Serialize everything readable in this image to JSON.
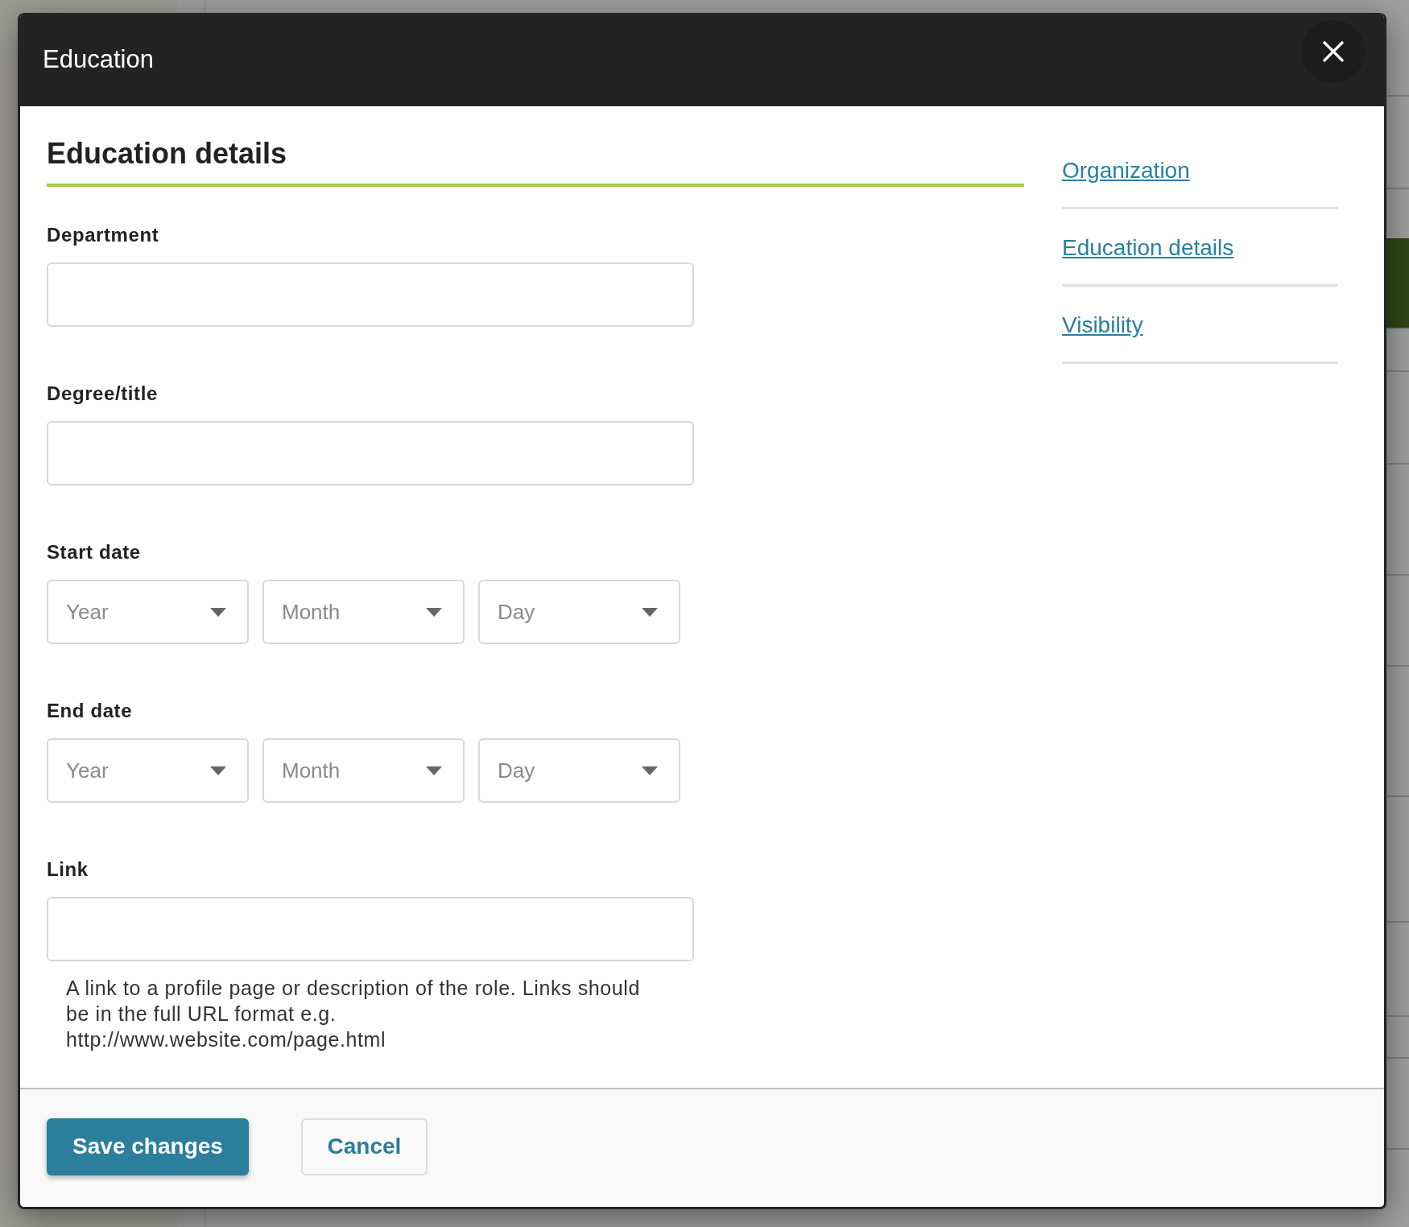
{
  "dialog": {
    "title": "Education"
  },
  "section_title": "Education details",
  "fields": [
    {
      "kind": "text",
      "label": "Department"
    },
    {
      "kind": "text",
      "label": "Degree/title"
    },
    {
      "kind": "date",
      "label": "Start date",
      "selects": [
        {
          "placeholder": "Year"
        },
        {
          "placeholder": "Month"
        },
        {
          "placeholder": "Day"
        }
      ]
    },
    {
      "kind": "date",
      "label": "End date",
      "selects": [
        {
          "placeholder": "Year"
        },
        {
          "placeholder": "Month"
        },
        {
          "placeholder": "Day"
        }
      ]
    },
    {
      "kind": "text",
      "label": "Link",
      "help": "A link to a profile page or description of the role. Links should be in the full URL format e.g. http://www.website.com/page.html"
    }
  ],
  "nav": [
    {
      "label": "Organization"
    },
    {
      "label": "Education details"
    },
    {
      "label": "Visibility"
    }
  ],
  "buttons": [
    {
      "kind": "primary",
      "label": "Save changes"
    },
    {
      "kind": "secondary",
      "label": "Cancel"
    }
  ]
}
